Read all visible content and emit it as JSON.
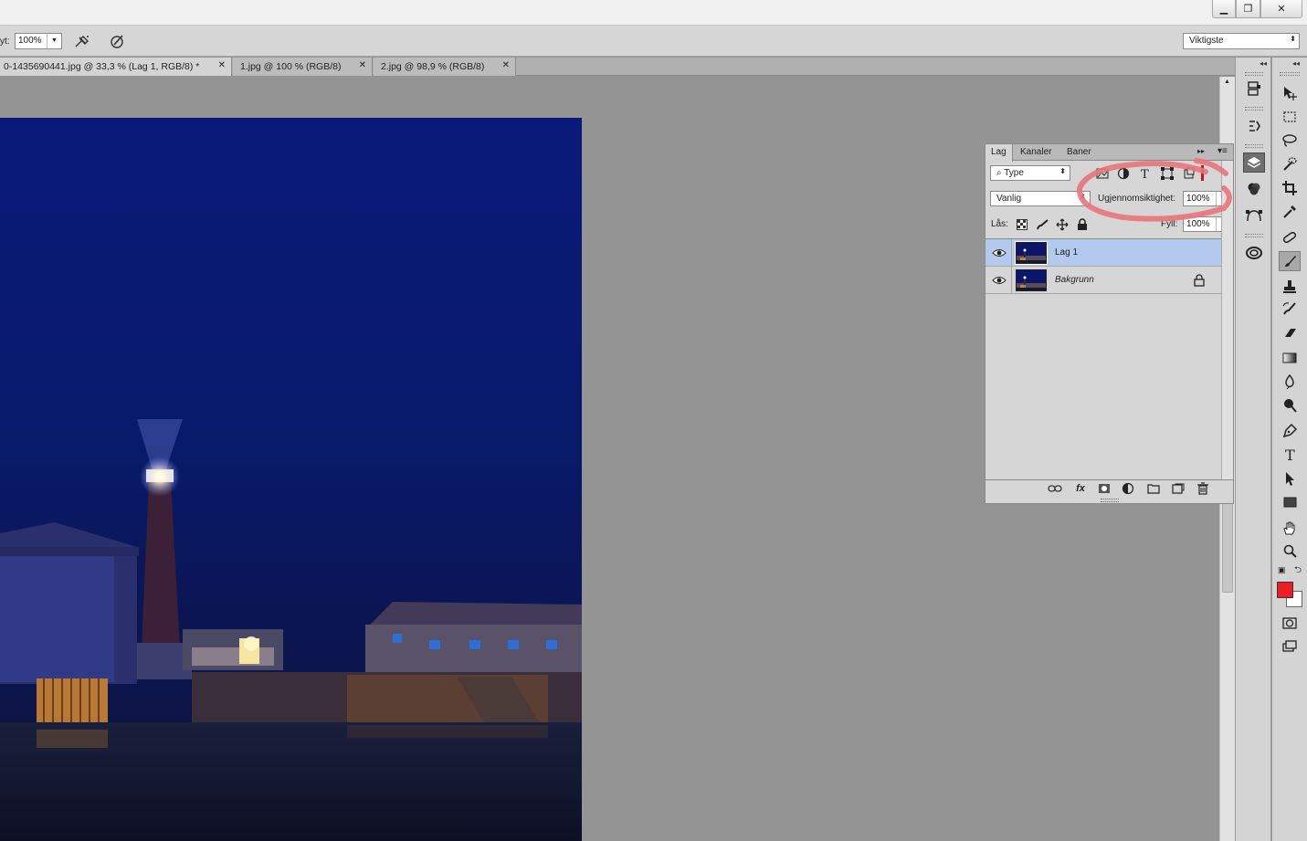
{
  "window": {
    "minimize_glyph": "▁",
    "restore_glyph": "❐",
    "close_glyph": "✕"
  },
  "options": {
    "flow_label": "yt:",
    "flow_value": "100%",
    "workspace": "Viktigste"
  },
  "doc_tabs": [
    {
      "label": "0-1435690441.jpg @ 33,3 % (Lag 1, RGB/8) *",
      "active": true
    },
    {
      "label": "1.jpg @ 100 % (RGB/8)",
      "active": false
    },
    {
      "label": "2.jpg @ 98,9 % (RGB/8)",
      "active": false
    }
  ],
  "layers_panel": {
    "tabs": [
      "Lag",
      "Kanaler",
      "Baner"
    ],
    "filter_kind": "Type",
    "blend_mode": "Vanlig",
    "opacity_label": "Ugjennomsiktighet:",
    "opacity_value": "100%",
    "lock_label": "Lås:",
    "fill_label": "Fyll:",
    "fill_value": "100%",
    "layers": [
      {
        "name": "Lag 1",
        "visible": true,
        "selected": true,
        "locked": false
      },
      {
        "name": "Bakgrunn",
        "visible": true,
        "selected": false,
        "locked": true
      }
    ],
    "footer_icons": [
      "link-icon",
      "fx-icon",
      "mask-icon",
      "adjustment-icon",
      "folder-icon",
      "new-layer-icon",
      "trash-icon"
    ]
  },
  "colors": {
    "foreground": "#ee1c24",
    "background": "#ffffff",
    "selection": "#b4c9ee",
    "annotation": "#e8747a"
  },
  "dock_icons": [
    "history-icon",
    "actions-icon",
    "layers-icon",
    "channels-icon",
    "paths-icon",
    "creative-cloud-icon"
  ],
  "tools": [
    "move-tool",
    "marquee-tool",
    "lasso-tool",
    "quick-select-tool",
    "crop-tool",
    "eyedropper-tool",
    "healing-brush-tool",
    "brush-tool",
    "clone-stamp-tool",
    "history-brush-tool",
    "eraser-tool",
    "gradient-tool",
    "blur-tool",
    "dodge-tool",
    "pen-tool",
    "type-tool",
    "path-select-tool",
    "rectangle-tool",
    "hand-tool",
    "zoom-tool"
  ]
}
